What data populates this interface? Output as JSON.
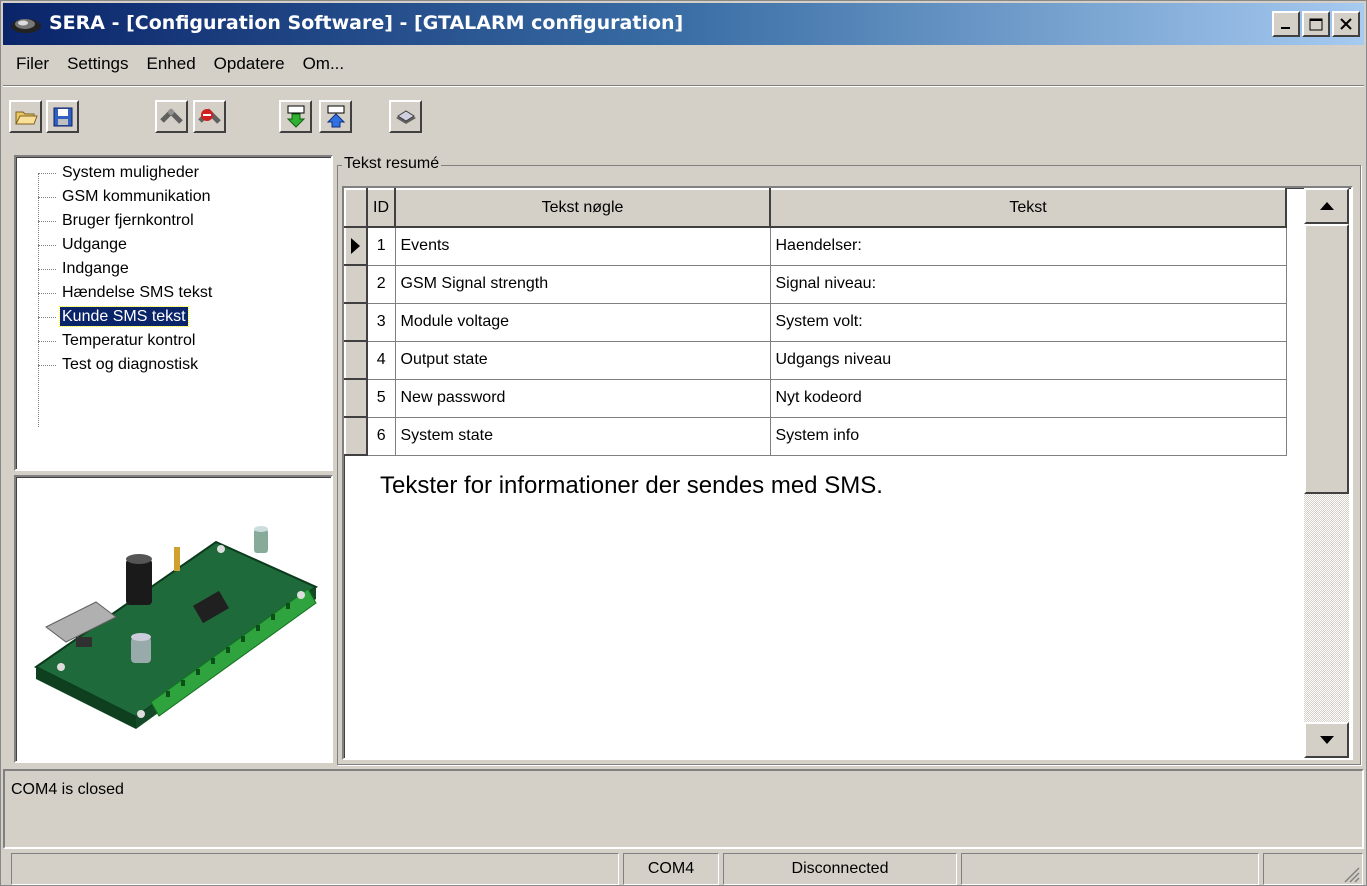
{
  "window": {
    "title": "SERA - [Configuration Software] - [GTALARM configuration]"
  },
  "menu": [
    "Filer",
    "Settings",
    "Enhed",
    "Opdatere",
    "Om..."
  ],
  "toolbar": {
    "buttons": [
      "open-folder-icon",
      "save-disk-icon",
      "connect-icon",
      "disconnect-icon",
      "download-to-device-icon",
      "upload-from-device-icon",
      "device-info-icon"
    ]
  },
  "tree": {
    "items": [
      "System muligheder",
      "GSM kommunikation",
      "Bruger fjernkontrol",
      "Udgange",
      "Indgange",
      "Hændelse SMS tekst",
      "Kunde SMS tekst",
      "Temperatur kontrol",
      "Test og diagnostisk"
    ],
    "selected": "Kunde SMS tekst"
  },
  "group": {
    "title": "Tekst resumé"
  },
  "grid": {
    "columns": [
      "ID",
      "Tekst nøgle",
      "Tekst"
    ],
    "rows": [
      {
        "id": "1",
        "key": "Events",
        "text": "Haendelser:"
      },
      {
        "id": "2",
        "key": "GSM Signal strength",
        "text": "Signal niveau:"
      },
      {
        "id": "3",
        "key": "Module voltage",
        "text": "System volt:"
      },
      {
        "id": "4",
        "key": "Output state",
        "text": "Udgangs niveau"
      },
      {
        "id": "5",
        "key": "New password",
        "text": "Nyt kodeord"
      },
      {
        "id": "6",
        "key": "System state",
        "text": "System info"
      }
    ]
  },
  "info_text": "Tekster for informationer der sendes med SMS.",
  "log": {
    "text": "COM4 is closed"
  },
  "status": {
    "port": "COM4",
    "connection": "Disconnected"
  },
  "colors": {
    "selection": "#0a246a",
    "face": "#d4d0c8"
  }
}
